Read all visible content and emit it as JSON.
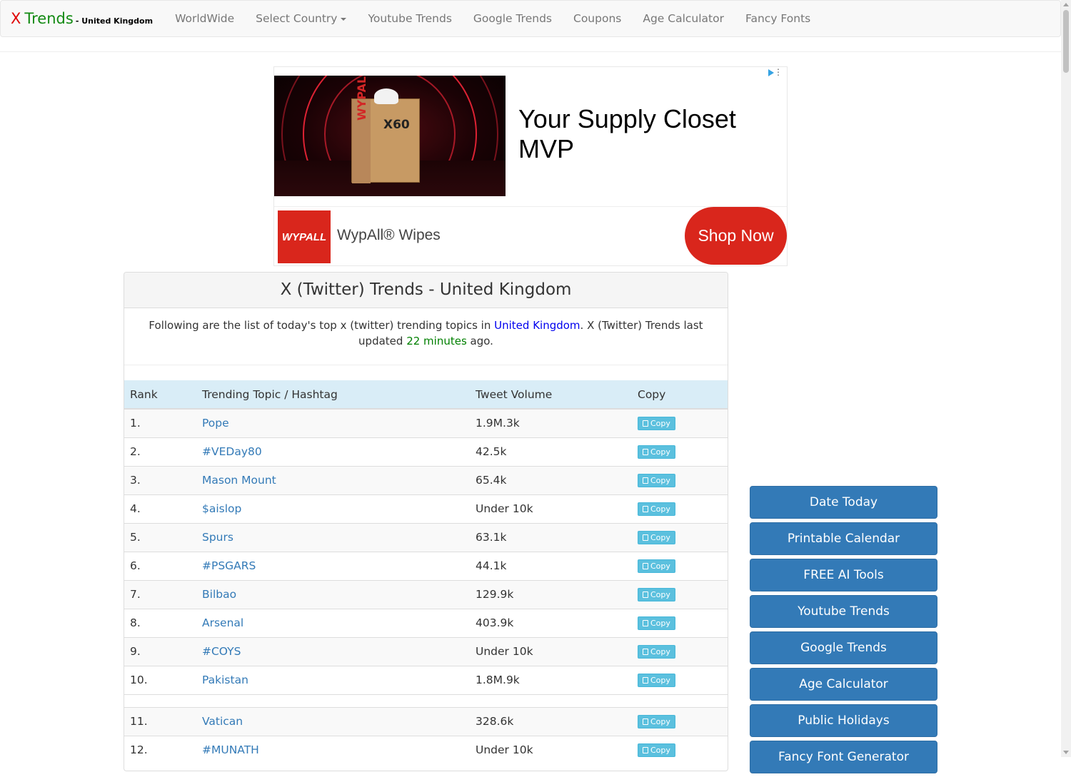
{
  "brand": {
    "x": "X",
    "trends": "Trends",
    "country": "- United Kingdom"
  },
  "nav": {
    "items": [
      "WorldWide",
      "Select Country",
      "Youtube Trends",
      "Google Trends",
      "Coupons",
      "Age Calculator",
      "Fancy Fonts"
    ]
  },
  "ad": {
    "headline": "Your Supply Closet MVP",
    "brand_logo_text": "WYPALL",
    "brand_name": "WypAll® Wipes",
    "cta": "Shop Now",
    "box_label": "X60",
    "colors": {
      "cta": "#d9261c"
    }
  },
  "panel": {
    "heading": "X (Twitter) Trends - United Kingdom",
    "intro_pre": "Following are the list of today's top x (twitter) trending topics in ",
    "intro_country": "United Kingdom",
    "intro_mid": ". X (Twitter) Trends last updated ",
    "intro_time": "22 minutes",
    "intro_post": " ago."
  },
  "table": {
    "headers": [
      "Rank",
      "Trending Topic / Hashtag",
      "Tweet Volume",
      "Copy"
    ],
    "copy_label": "Copy",
    "rows": [
      {
        "rank": "1.",
        "topic": "Pope",
        "volume": "1.9M.3k"
      },
      {
        "rank": "2.",
        "topic": "#VEDay80",
        "volume": "42.5k"
      },
      {
        "rank": "3.",
        "topic": "Mason Mount",
        "volume": "65.4k"
      },
      {
        "rank": "4.",
        "topic": "$aislop",
        "volume": "Under 10k"
      },
      {
        "rank": "5.",
        "topic": "Spurs",
        "volume": "63.1k"
      },
      {
        "rank": "6.",
        "topic": "#PSGARS",
        "volume": "44.1k"
      },
      {
        "rank": "7.",
        "topic": "Bilbao",
        "volume": "129.9k"
      },
      {
        "rank": "8.",
        "topic": "Arsenal",
        "volume": "403.9k"
      },
      {
        "rank": "9.",
        "topic": "#COYS",
        "volume": "Under 10k"
      },
      {
        "rank": "10.",
        "topic": "Pakistan",
        "volume": "1.8M.9k"
      },
      {
        "rank": "11.",
        "topic": "Vatican",
        "volume": "328.6k"
      },
      {
        "rank": "12.",
        "topic": "#MUNATH",
        "volume": "Under 10k"
      }
    ]
  },
  "sidebar": {
    "links": [
      "Date Today",
      "Printable Calendar",
      "FREE AI Tools",
      "Youtube Trends",
      "Google Trends",
      "Age Calculator",
      "Public Holidays",
      "Fancy Font Generator"
    ]
  },
  "colors": {
    "primary": "#337ab7",
    "info": "#5bc0de",
    "table_header": "#d9edf7",
    "brand_red": "#e00000",
    "brand_green": "#138a13"
  }
}
